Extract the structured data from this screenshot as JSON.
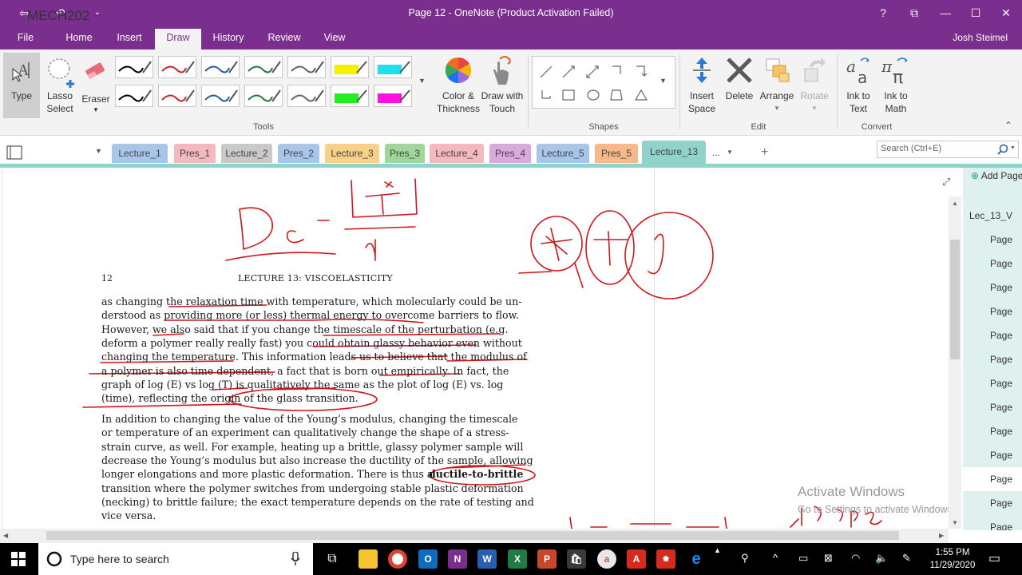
{
  "window": {
    "title": "Page 12 - OneNote (Product Activation Failed)",
    "user": "Josh Steimel",
    "help": "?",
    "restore_box": "⧉",
    "minimize": "—",
    "maximize": "☐",
    "close": "✕"
  },
  "menu": {
    "tabs": [
      "File",
      "Home",
      "Insert",
      "Draw",
      "History",
      "Review",
      "View"
    ],
    "active": "Draw"
  },
  "ribbon": {
    "type_label": "Type",
    "lasso_label": [
      "Lasso",
      "Select"
    ],
    "eraser_label": "Eraser",
    "color_label": [
      "Color &",
      "Thickness"
    ],
    "draw_touch_label": [
      "Draw with",
      "Touch"
    ],
    "insert_space_label": [
      "Insert",
      "Space"
    ],
    "delete_label": "Delete",
    "arrange_label": "Arrange",
    "rotate_label": "Rotate",
    "ink_text_label": [
      "Ink to",
      "Text"
    ],
    "ink_math_label": [
      "Ink to",
      "Math"
    ],
    "groups": [
      "Tools",
      "Shapes",
      "Edit",
      "Convert"
    ],
    "pen_colors": [
      "#000000",
      "#d22222",
      "#2a5aa8",
      "#1e7a3c",
      "#666666",
      "#f4f000",
      "#1ce0f0",
      "#000000",
      "#d22222",
      "#2a5aa8",
      "#1e7a3c",
      "#666666",
      "#22ee22",
      "#ff10e0"
    ]
  },
  "notebook": {
    "name": "MECH202",
    "sections": [
      {
        "label": "Lecture_1",
        "color": "#a9c6ea"
      },
      {
        "label": "Pres_1",
        "color": "#f3b9bf"
      },
      {
        "label": "Lecture_2",
        "color": "#c9c9c9"
      },
      {
        "label": "Pres_2",
        "color": "#a9c6ea"
      },
      {
        "label": "Lecture_3",
        "color": "#f7d08a"
      },
      {
        "label": "Pres_3",
        "color": "#9fd79a"
      },
      {
        "label": "Lecture_4",
        "color": "#f3b9bf"
      },
      {
        "label": "Pres_4",
        "color": "#d9a9dc"
      },
      {
        "label": "Lecture_5",
        "color": "#a9c6ea"
      },
      {
        "label": "Pres_5",
        "color": "#f7b98a"
      },
      {
        "label": "Lecture_13",
        "color": "#8fd3ca"
      }
    ],
    "more": "...",
    "add": "+",
    "search_placeholder": "Search (Ctrl+E)"
  },
  "document": {
    "page_number": "12",
    "header": "LECTURE 13:  VISCOELASTICITY",
    "para1": [
      "as changing the relaxation time with temperature, which molecularly could be un-",
      "derstood as providing more (or less) thermal energy to overcome barriers to flow.",
      "However, we also said that if you change the timescale of the perturbation (e.g.",
      "deform a polymer really really fast) you could obtain glassy behavior even without",
      "changing the temperature. This information leads us to believe that the modulus of",
      "a polymer is also time dependent, a fact that is born out empirically. In fact, the",
      "graph of log (E) vs log (T) is qualitatively the same as the plot of log (E) vs. log",
      "(time), reflecting the origin of the glass transition."
    ],
    "para2": [
      "In addition to changing the value of the Young’s modulus, changing the timescale",
      "or temperature of an experiment can qualitatively change the shape of a stress-",
      "strain curve, as well. For example, heating up a brittle, glassy polymer sample will",
      "decrease the Young’s modulus but also increase the ductility of the sample, allowing",
      "longer elongations and more plastic deformation. There is thus a",
      "transition where the polymer switches from undergoing stable plastic deformation",
      "(necking) to brittle failure; the exact temperature depends on the rate of testing and",
      "vice versa."
    ],
    "bold_term": "ductile-to-brittle"
  },
  "pages": {
    "add_page": "Add Page",
    "items": [
      "Lec_13_V",
      "Page",
      "Page",
      "Page",
      "Page",
      "Page",
      "Page",
      "Page",
      "Page",
      "Page",
      "Page",
      "Page",
      "Page",
      "Page",
      "Page"
    ],
    "selected_index": 11
  },
  "watermark": {
    "line1": "Activate Windows",
    "line2": "Go to Settings to activate Windows."
  },
  "taskbar": {
    "search_placeholder": "Type here to search",
    "time": "1:55 PM",
    "date": "11/29/2020"
  }
}
